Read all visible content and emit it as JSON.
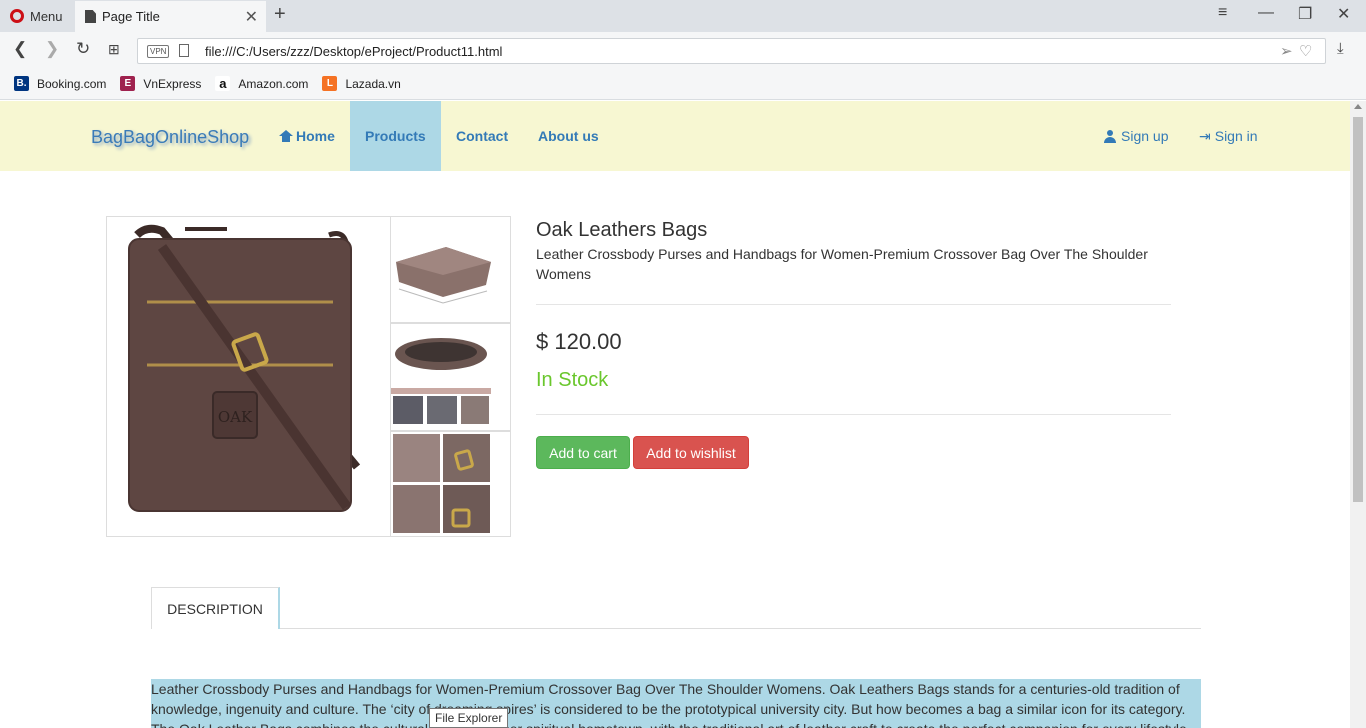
{
  "browser": {
    "menu_label": "Menu",
    "tab_title": "Page Title",
    "url": "file:///C:/Users/zzz/Desktop/eProject/Product11.html",
    "vpn_label": "VPN",
    "bookmarks": [
      {
        "label": "Booking.com",
        "icon": "booking-icon",
        "color": "#003580",
        "glyph": "B."
      },
      {
        "label": "VnExpress",
        "icon": "vnexpress-icon",
        "color": "#9f224e",
        "glyph": "E"
      },
      {
        "label": "Amazon.com",
        "icon": "amazon-icon",
        "color": "#ffffff",
        "glyph": "a"
      },
      {
        "label": "Lazada.vn",
        "icon": "lazada-icon",
        "color": "#f57224",
        "glyph": "L"
      }
    ]
  },
  "site": {
    "brand": "BagBagOnlineShop",
    "nav": {
      "home": "Home",
      "products": "Products",
      "contact": "Contact",
      "about": "About us",
      "signup": "Sign up",
      "signin": "Sign in"
    }
  },
  "product": {
    "name": "Oak Leathers Bags",
    "subtitle": "Leather Crossbody Purses and Handbags for Women-Premium Crossover Bag Over The Shoulder Womens",
    "price": "$ 120.00",
    "stock": "In Stock",
    "add_to_cart": "Add to cart",
    "add_to_wishlist": "Add to wishlist",
    "logo_text": "OAK"
  },
  "description": {
    "tab_label": "DESCRIPTION",
    "text": "Leather Crossbody Purses and Handbags for Women-Premium Crossover Bag Over The Shoulder Womens. Oak Leathers Bags stands for a centuries-old tradition of knowledge, ingenuity and culture. The ‘city of dreaming spires’ is considered to be the prototypical university city. But how becomes a bag a similar icon for its category. The Oak Leather Bags combines the cultural heritage of her spiritual hometown, with the traditional art of leather craft to create the perfect companion for every lifestyle."
  },
  "tooltip": "File Explorer",
  "colors": {
    "navbar_bg": "#f7f7d2",
    "active_nav": "#add8e6",
    "link": "#337ab7",
    "in_stock": "#6ac72d",
    "cart_button": "#5cb85c",
    "wishlist_button": "#d9534f"
  }
}
